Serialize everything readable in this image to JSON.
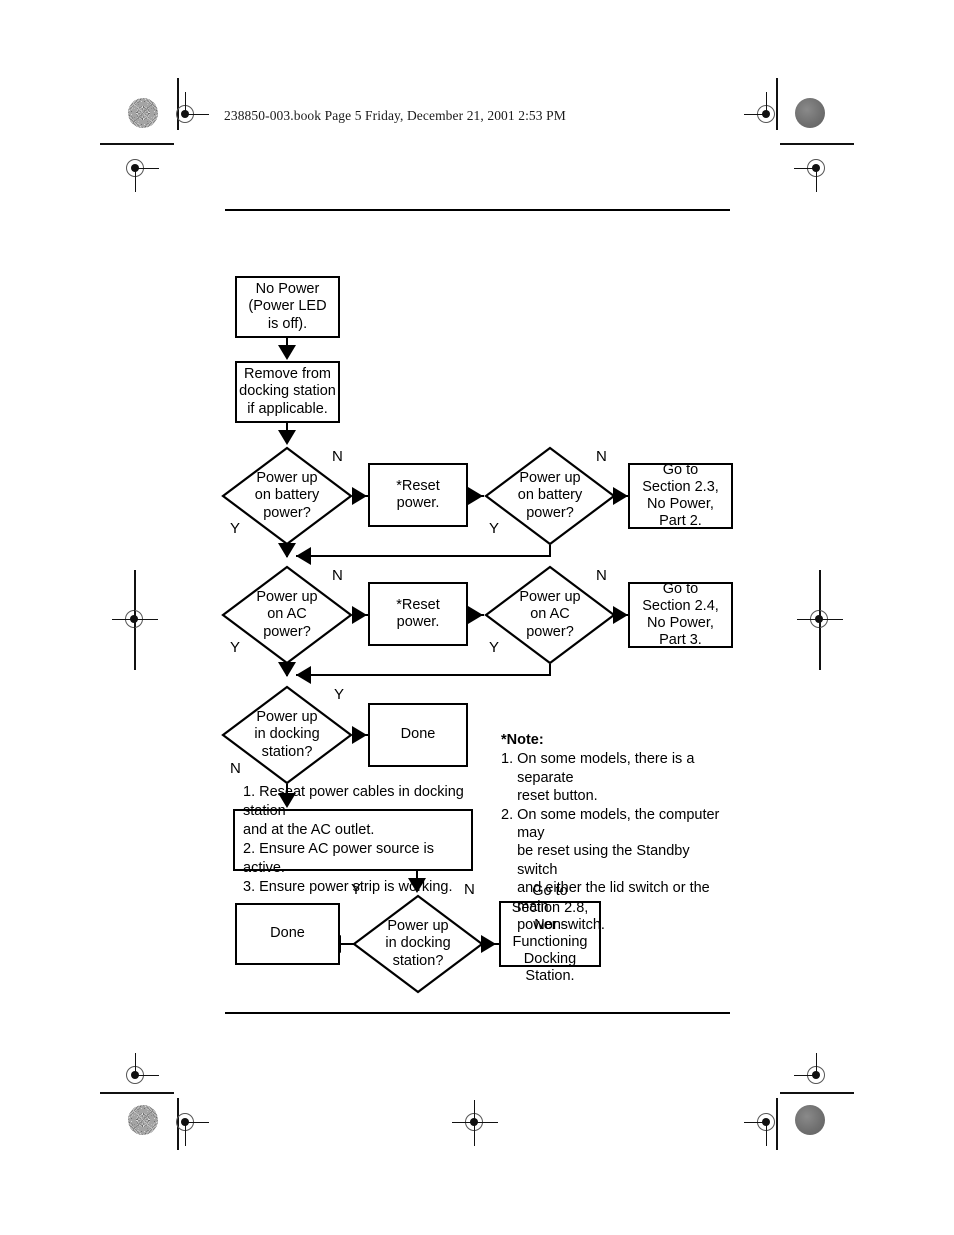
{
  "page": {
    "book_header": "238850-003.book  Page 5  Friday, December 21, 2001  2:53 PM"
  },
  "chart_data": {
    "type": "diagram",
    "title": "No Power (Power LED is off) troubleshooting flowchart",
    "nodes": [
      {
        "id": "n1",
        "shape": "box",
        "text": "No Power\n(Power LED\nis off)."
      },
      {
        "id": "n2",
        "shape": "box",
        "text": "Remove from\ndocking station\nif applicable."
      },
      {
        "id": "d1",
        "shape": "diamond",
        "text": "Power up\non battery\npower?"
      },
      {
        "id": "n3",
        "shape": "box",
        "text": "*Reset\npower."
      },
      {
        "id": "d2",
        "shape": "diamond",
        "text": "Power up\non battery\npower?"
      },
      {
        "id": "n4",
        "shape": "box",
        "text": "Go to\nSection 2.3,\nNo Power,\nPart 2."
      },
      {
        "id": "d3",
        "shape": "diamond",
        "text": "Power up\non AC\npower?"
      },
      {
        "id": "n5",
        "shape": "box",
        "text": "*Reset\npower."
      },
      {
        "id": "d4",
        "shape": "diamond",
        "text": "Power up\non AC\npower?"
      },
      {
        "id": "n6",
        "shape": "box",
        "text": "Go to\nSection 2.4,\nNo Power,\nPart 3."
      },
      {
        "id": "d5",
        "shape": "diamond",
        "text": "Power up\nin docking\nstation?"
      },
      {
        "id": "n7",
        "shape": "box",
        "text": "Done"
      },
      {
        "id": "n8",
        "shape": "box",
        "text": "1. Reseat power cables in docking station\n     and at the AC outlet.\n2. Ensure AC power source is active.\n3. Ensure power strip is working."
      },
      {
        "id": "d6",
        "shape": "diamond",
        "text": "Power up\nin docking\nstation?"
      },
      {
        "id": "n9",
        "shape": "box",
        "text": "Done"
      },
      {
        "id": "n10",
        "shape": "box",
        "text": "Go to\nSection 2.8,\nNon-Functioning\nDocking Station."
      }
    ],
    "edges": [
      {
        "from": "n1",
        "to": "n2",
        "label": ""
      },
      {
        "from": "n2",
        "to": "d1",
        "label": ""
      },
      {
        "from": "d1",
        "to": "n3",
        "label": "N"
      },
      {
        "from": "d1",
        "to": "d3",
        "label": "Y"
      },
      {
        "from": "n3",
        "to": "d2",
        "label": ""
      },
      {
        "from": "d2",
        "to": "n4",
        "label": "N"
      },
      {
        "from": "d2",
        "to": "d3",
        "label": "Y"
      },
      {
        "from": "d3",
        "to": "n5",
        "label": "N"
      },
      {
        "from": "d3",
        "to": "d5",
        "label": "Y"
      },
      {
        "from": "n5",
        "to": "d4",
        "label": ""
      },
      {
        "from": "d4",
        "to": "n6",
        "label": "N"
      },
      {
        "from": "d4",
        "to": "d5",
        "label": "Y"
      },
      {
        "from": "d5",
        "to": "n7",
        "label": "Y"
      },
      {
        "from": "d5",
        "to": "n8",
        "label": "N"
      },
      {
        "from": "n8",
        "to": "d6",
        "label": ""
      },
      {
        "from": "d6",
        "to": "n9",
        "label": "Y"
      },
      {
        "from": "d6",
        "to": "n10",
        "label": "N"
      }
    ]
  },
  "flow": {
    "n1": "No Power\n(Power LED\nis off).",
    "n2": "Remove from\ndocking station\nif applicable.",
    "d1": "Power up\non battery\npower?",
    "n3": "*Reset\npower.",
    "d2": "Power up\non battery\npower?",
    "n4": "Go to\nSection 2.3,\nNo Power,\nPart 2.",
    "d3": "Power up\non AC\npower?",
    "n5": "*Reset\npower.",
    "d4": "Power up\non AC\npower?",
    "n6": "Go to\nSection 2.4,\nNo Power,\nPart 3.",
    "d5": "Power up\nin docking\nstation?",
    "n7": "Done",
    "n8": "1. Reseat power cables in docking station\n     and at the AC outlet.\n2. Ensure AC power source is active.\n3. Ensure power strip is working.",
    "d6": "Power up\nin docking\nstation?",
    "n9": "Done",
    "n10": "Go to\nSection 2.8,\nNon-Functioning\nDocking Station."
  },
  "labels": {
    "r1_n": "N",
    "r1_n2": "N",
    "r1_y": "Y",
    "r1_y2": "Y",
    "r2_n": "N",
    "r2_n2": "N",
    "r2_y": "Y",
    "r2_y2": "Y",
    "r3_y": "Y",
    "r3_n": "N",
    "r4_y": "Y",
    "r4_n": "N"
  },
  "note": {
    "title": "*Note:",
    "items": [
      {
        "num": "1.",
        "text": "On some models, there is a separate\nreset button."
      },
      {
        "num": "2.",
        "text": "On some models, the computer may\nbe reset using the Standby switch\nand either the lid switch or the main\npower switch."
      }
    ]
  }
}
